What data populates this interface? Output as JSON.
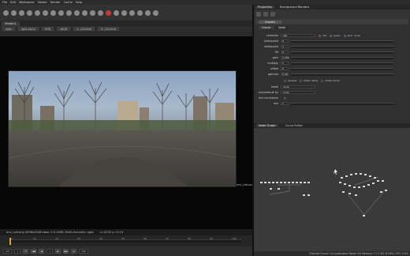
{
  "menubar": {
    "items": [
      "File",
      "Edit",
      "Workspace",
      "Viewer",
      "Render",
      "Cache",
      "Help"
    ]
  },
  "viewer": {
    "tab_label": "Viewer1",
    "controls": [
      "rgba",
      "rgba.alpha",
      "RGB",
      "sRGB",
      "A  _lShcford",
      "B  _lShcford"
    ],
    "image_label": "env_LatLong_4096",
    "info_text": "env_LatLong 4096x2048  bbox: 0 0 4096 2048 channels: rgba",
    "coords_text": "x=4130 y=1113"
  },
  "timeline": {
    "ticks": [
      "1",
      "10",
      "20",
      "30",
      "40",
      "50",
      "60",
      "70",
      "80",
      "90",
      "100"
    ],
    "frame": "1",
    "fps": "24*",
    "range_start": "1",
    "range_end": "100"
  },
  "properties": {
    "tabs": [
      "Properties",
      "Background Renders"
    ],
    "node_name": "Grade1",
    "subtabs": [
      "Grade",
      "Node"
    ],
    "channels_label": "channels",
    "channels_value": "rgb",
    "channel_chips": [
      "red",
      "green",
      "blue",
      "none"
    ],
    "knobs": [
      {
        "label": "blackpoint",
        "value": "0"
      },
      {
        "label": "whitepoint",
        "value": "1"
      },
      {
        "label": "lift",
        "value": "0"
      },
      {
        "label": "gain",
        "value": "1.255"
      },
      {
        "label": "multiply",
        "value": "1"
      },
      {
        "label": "offset",
        "value": "0"
      },
      {
        "label": "gamma",
        "value": "0.36"
      }
    ],
    "reverse_label": "reverse",
    "black_clamp_label": "black clamp",
    "white_clamp_label": "white clamp",
    "mask_label": "mask",
    "mask_value": "none",
    "luminance_mix_label": "(un)premult by",
    "luminance_mix_value": "none",
    "mix_luminance_label": "mix luminance",
    "mix_label": "mix",
    "mix_value": "1"
  },
  "dag": {
    "tabs": [
      "Node Graph",
      "Curve Editor"
    ]
  },
  "status": {
    "text": "Channel Count: 14  Localization Mode: On  Memory: 17.2 GB (53.8%)  CPU: 0.0%"
  },
  "colors": {
    "accent_orange": "#e8a022",
    "red_chip": "#c23a3a",
    "green_chip": "#3aa33a",
    "blue_chip": "#3a63c2"
  }
}
